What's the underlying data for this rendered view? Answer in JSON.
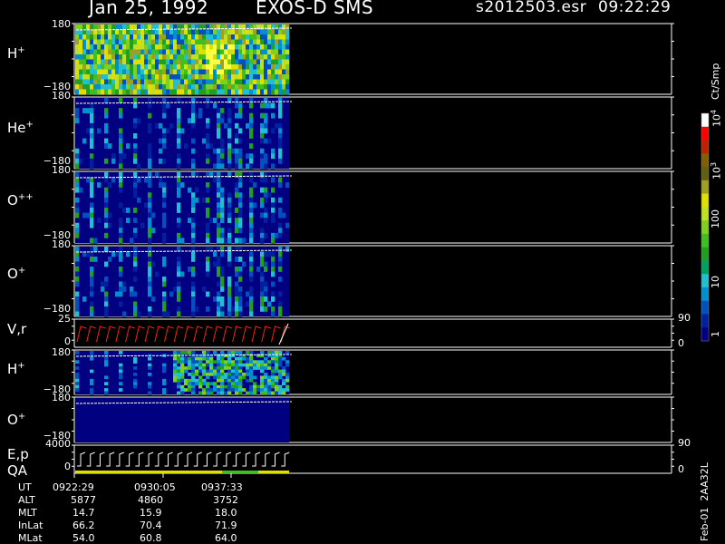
{
  "header": {
    "date": "Jan 25, 1992",
    "instrument": "EXOS-D SMS",
    "file": "s2012503.esr",
    "time": "09:22:29"
  },
  "panels": [
    {
      "label": "H",
      "sup": "+",
      "ytop": "180",
      "ybot": "−180"
    },
    {
      "label": "He",
      "sup": "+",
      "ytop": "180",
      "ybot": "−180"
    },
    {
      "label": "O",
      "sup": "++",
      "ytop": "180",
      "ybot": "−180"
    },
    {
      "label": "O",
      "sup": "+",
      "ytop": "180",
      "ybot": "−180"
    },
    {
      "label": "V,r",
      "sup": "",
      "ytop": "25",
      "ybot": "0",
      "rtop": "90",
      "rbot": "0"
    },
    {
      "label": "H",
      "sup": "+",
      "ytop": "180",
      "ybot": "−180"
    },
    {
      "label": "O",
      "sup": "+",
      "ytop": "180",
      "ybot": "−180"
    },
    {
      "label": "E,p",
      "label2": "QA",
      "sup": "",
      "ytop": "4000",
      "ybot": "0",
      "rtop": "90",
      "rbot": "0"
    }
  ],
  "colorbar": {
    "unit": "Ct/Smp",
    "labels": {
      "l1": "1",
      "l10": "10",
      "l100": "100",
      "l1000": "10",
      "l1000sup": "3",
      "l10000": "10",
      "l10000sup": "4"
    },
    "colors": [
      "#000080",
      "#0020a0",
      "#0050c0",
      "#0090d0",
      "#20c0d0",
      "#00a060",
      "#20a020",
      "#40c020",
      "#80d020",
      "#c0e020",
      "#e0e000",
      "#a0a020",
      "#606010",
      "#806000",
      "#c02000",
      "#ff0000",
      "#ffffff"
    ]
  },
  "footer": {
    "ut_label": "UT",
    "ut": [
      "0922:29",
      "0930:05",
      "0937:33"
    ],
    "alt_label": "ALT",
    "alt": [
      "5877",
      "4860",
      "3752"
    ],
    "mlt_label": "MLT",
    "mlt": [
      "14.7",
      "15.9",
      "18.0"
    ],
    "inlat_label": "InLat",
    "inlat": [
      "66.2",
      "70.4",
      "71.9"
    ],
    "mlat_label": "MLat",
    "mlat": [
      "54.0",
      "60.8",
      "64.0"
    ]
  },
  "side_note": "Feb-01  2AA32L",
  "chart_data": {
    "type": "heatmap",
    "title": "Jan 25, 1992   EXOS-D SMS",
    "xlabel": "UT",
    "x_ticks": [
      "0922:29",
      "0930:05",
      "0937:33"
    ],
    "panels": [
      "H+",
      "He+",
      "O++",
      "O+",
      "V,r",
      "H+",
      "O+",
      "E,p QA"
    ],
    "pitch_angle_range": [
      -180,
      180
    ],
    "colorbar_unit": "Ct/Smp",
    "colorbar_range": [
      1,
      10000
    ],
    "colorbar_scale": "log"
  }
}
